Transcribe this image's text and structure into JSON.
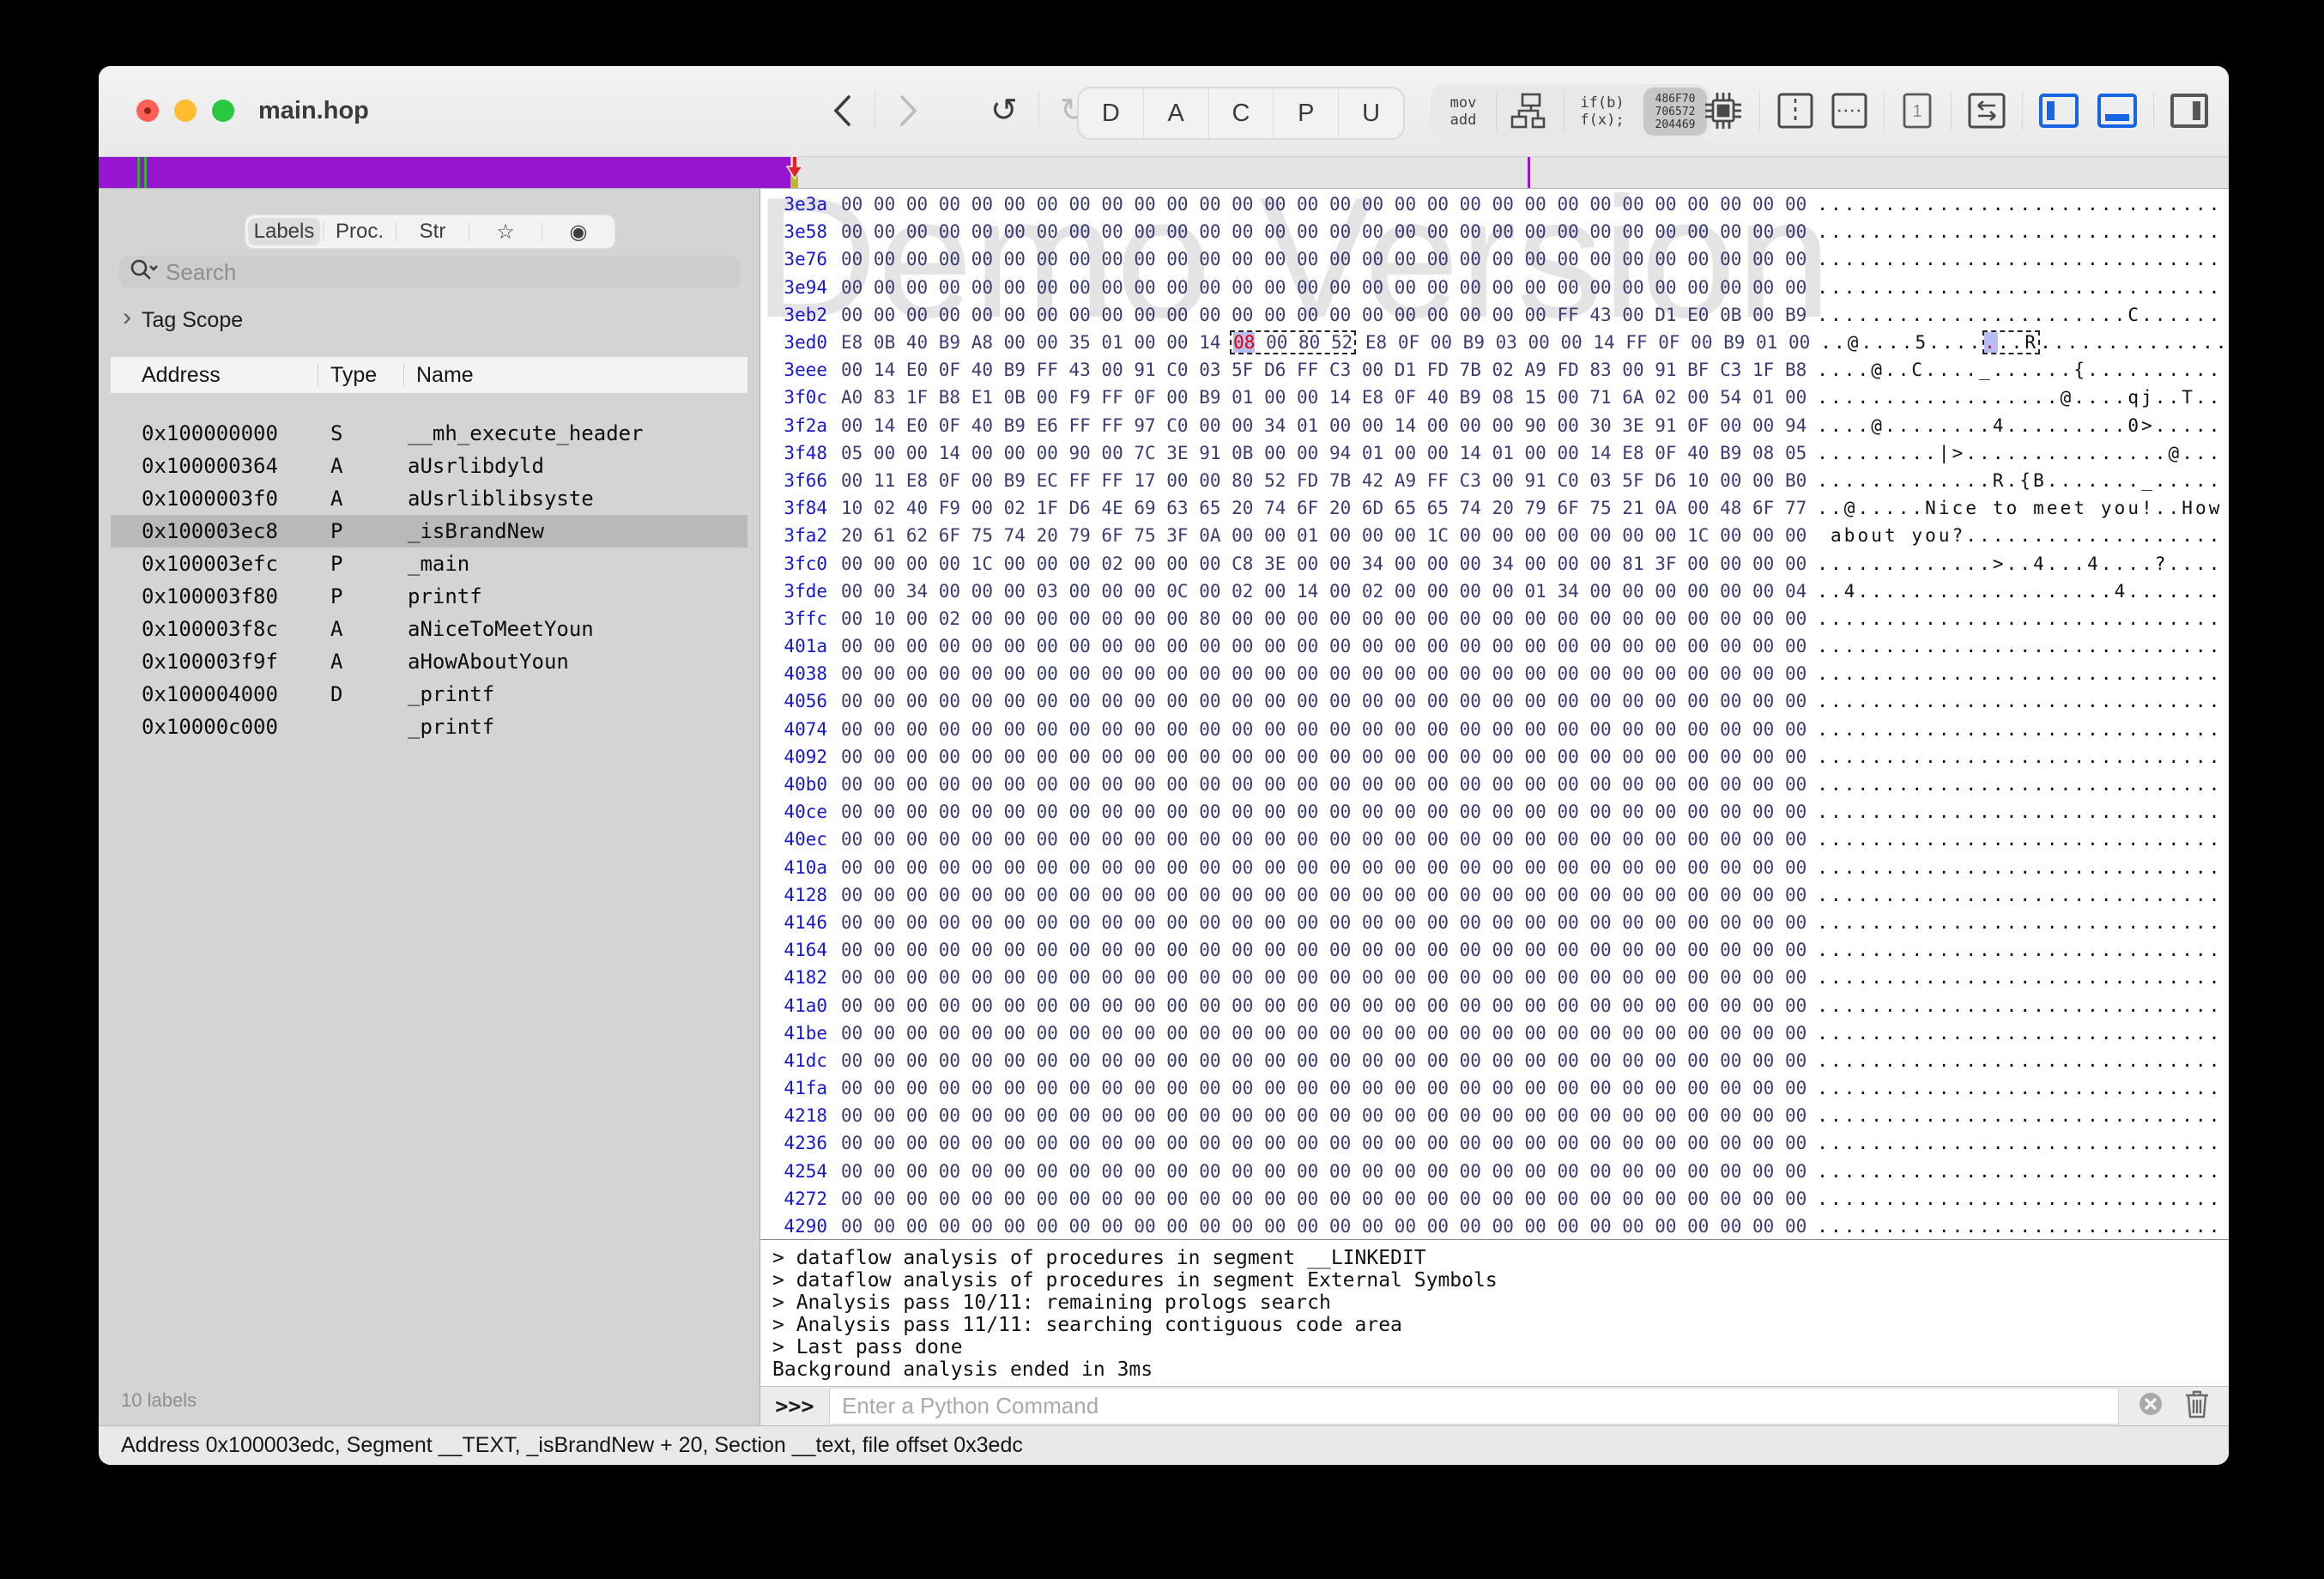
{
  "window": {
    "title": "main.hop"
  },
  "colors": {
    "accent_blue": "#1565e5",
    "nav_purple": "#9714d0",
    "nav_green": "#2db32d",
    "nav_olive": "#b9b92a",
    "marker_red": "#e02525",
    "address_blue": "#1717cc",
    "byte_navy": "#3b3b72",
    "selection_lavender": "#b7bef5",
    "selection_red": "#e00000",
    "selected_row_gray": "#b9b9b9"
  },
  "toolbar": {
    "modes": [
      "D",
      "A",
      "C",
      "P",
      "U"
    ],
    "asm": {
      "line1": "mov",
      "line2": "add"
    },
    "pseudo": {
      "line1": "if(b)",
      "line2": "f(x);"
    },
    "hexbadge": {
      "line1": "486F70",
      "line2": "706572",
      "line3": "204469"
    },
    "one_label": "1",
    "icons": [
      "back-icon",
      "forward-icon",
      "undo-icon",
      "redo-icon",
      "graph-view-icon",
      "cpu-icon",
      "split-vertical-icon",
      "split-horizontal-icon",
      "single-pane-icon",
      "swap-arrows-icon",
      "left-panel-toggle-icon",
      "bottom-panel-toggle-icon",
      "right-panel-toggle-icon"
    ]
  },
  "sidebar": {
    "tabs": [
      {
        "label": "Labels",
        "selected": true
      },
      {
        "label": "Proc.",
        "selected": false
      },
      {
        "label": "Str",
        "selected": false
      },
      {
        "label": "☆",
        "selected": false
      },
      {
        "label": "◉",
        "selected": false
      }
    ],
    "search_placeholder": "Search",
    "tag_scope_label": "Tag Scope",
    "table": {
      "headers": [
        "Address",
        "Type",
        "Name"
      ],
      "selected_index": 3,
      "rows": [
        {
          "address": "0x100000000",
          "type": "S",
          "name": "__mh_execute_header"
        },
        {
          "address": "0x100000364",
          "type": "A",
          "name": "aUsrlibdyld"
        },
        {
          "address": "0x1000003f0",
          "type": "A",
          "name": "aUsrliblibsyste"
        },
        {
          "address": "0x100003ec8",
          "type": "P",
          "name": "_isBrandNew"
        },
        {
          "address": "0x100003efc",
          "type": "P",
          "name": "_main"
        },
        {
          "address": "0x100003f80",
          "type": "P",
          "name": "printf"
        },
        {
          "address": "0x100003f8c",
          "type": "A",
          "name": "aNiceToMeetYoun"
        },
        {
          "address": "0x100003f9f",
          "type": "A",
          "name": "aHowAboutYoun"
        },
        {
          "address": "0x100004000",
          "type": "D",
          "name": "_printf"
        },
        {
          "address": "0x10000c000",
          "type": "",
          "name": "_printf"
        }
      ]
    },
    "footer": "10 labels"
  },
  "hexview": {
    "watermark": "Demo Version",
    "zero_hex": "00 00 00 00 00 00 00 00 00 00 00 00 00 00 00 00 00 00 00 00 00 00 00 00 00 00 00 00 00 00",
    "zero_ascii": "..............................",
    "rows": [
      {
        "a": "3e3a"
      },
      {
        "a": "3e58"
      },
      {
        "a": "3e76"
      },
      {
        "a": "3e94"
      },
      {
        "a": "3eb2",
        "h": "00 00 00 00 00 00 00 00 00 00 00 00 00 00 00 00 00 00 00 00 00 00 FF 43 00 D1 E0 0B 00 B9",
        "t": ".......................C......"
      },
      {
        "a": "3ed0",
        "sel": {
          "hex_pre": "E8 0B 40 B9 A8 00 00 35 01 00 00 14 ",
          "sel_byte": "08",
          "box_rest": " 00 80 52",
          "hex_post": " E8 0F 00 B9 03 00 00 14 FF 0F 00 B9 01 00",
          "ascii_pre": "..@....5....",
          "ascii_sel": ".",
          "ascii_box_rest": "..R",
          "ascii_post": ".............."
        }
      },
      {
        "a": "3eee",
        "h": "00 14 E0 0F 40 B9 FF 43 00 91 C0 03 5F D6 FF C3 00 D1 FD 7B 02 A9 FD 83 00 91 BF C3 1F B8",
        "t": "....@..C...._......{.........."
      },
      {
        "a": "3f0c",
        "h": "A0 83 1F B8 E1 0B 00 F9 FF 0F 00 B9 01 00 00 14 E8 0F 40 B9 08 15 00 71 6A 02 00 54 01 00",
        "t": "..................@....qj..T.."
      },
      {
        "a": "3f2a",
        "h": "00 14 E0 0F 40 B9 E6 FF FF 97 C0 00 00 34 01 00 00 14 00 00 00 90 00 30 3E 91 0F 00 00 94",
        "t": "....@........4.........0>....."
      },
      {
        "a": "3f48",
        "h": "05 00 00 14 00 00 00 90 00 7C 3E 91 0B 00 00 94 01 00 00 14 01 00 00 14 E8 0F 40 B9 08 05",
        "t": ".........|>...............@..."
      },
      {
        "a": "3f66",
        "h": "00 11 E8 0F 00 B9 EC FF FF 17 00 00 80 52 FD 7B 42 A9 FF C3 00 91 C0 03 5F D6 10 00 00 B0",
        "t": ".............R.{B......._....."
      },
      {
        "a": "3f84",
        "h": "10 02 40 F9 00 02 1F D6 4E 69 63 65 20 74 6F 20 6D 65 65 74 20 79 6F 75 21 0A 00 48 6F 77",
        "t": "..@.....Nice to meet you!..How"
      },
      {
        "a": "3fa2",
        "h": "20 61 62 6F 75 74 20 79 6F 75 3F 0A 00 00 01 00 00 00 1C 00 00 00 00 00 00 00 1C 00 00 00",
        "t": " about you?..................."
      },
      {
        "a": "3fc0",
        "h": "00 00 00 00 1C 00 00 00 02 00 00 00 C8 3E 00 00 34 00 00 00 34 00 00 00 81 3F 00 00 00 00",
        "t": ".............>..4...4....?...."
      },
      {
        "a": "3fde",
        "h": "00 00 34 00 00 00 03 00 00 00 0C 00 02 00 14 00 02 00 00 00 00 01 34 00 00 00 00 00 00 04",
        "t": "..4...................4......."
      },
      {
        "a": "3ffc",
        "h": "00 10 00 02 00 00 00 00 00 00 00 80 00 00 00 00 00 00 00 00 00 00 00 00 00 00 00 00 00 00",
        "t": ".............................."
      },
      {
        "a": "401a"
      },
      {
        "a": "4038"
      },
      {
        "a": "4056"
      },
      {
        "a": "4074"
      },
      {
        "a": "4092"
      },
      {
        "a": "40b0"
      },
      {
        "a": "40ce"
      },
      {
        "a": "40ec"
      },
      {
        "a": "410a"
      },
      {
        "a": "4128"
      },
      {
        "a": "4146"
      },
      {
        "a": "4164"
      },
      {
        "a": "4182"
      },
      {
        "a": "41a0"
      },
      {
        "a": "41be"
      },
      {
        "a": "41dc"
      },
      {
        "a": "41fa"
      },
      {
        "a": "4218"
      },
      {
        "a": "4236"
      },
      {
        "a": "4254"
      },
      {
        "a": "4272"
      },
      {
        "a": "4290"
      }
    ]
  },
  "console": {
    "lines": [
      "> dataflow analysis of procedures in segment __LINKEDIT",
      "> dataflow analysis of procedures in segment External Symbols",
      "> Analysis pass 10/11: remaining prologs search",
      "> Analysis pass 11/11: searching contiguous code area",
      "> Last pass done",
      "Background analysis ended in 3ms"
    ]
  },
  "python": {
    "prompt": ">>>",
    "placeholder": "Enter a Python Command"
  },
  "statusbar": {
    "text": "Address 0x100003edc, Segment __TEXT, _isBrandNew + 20, Section __text, file offset 0x3edc"
  }
}
